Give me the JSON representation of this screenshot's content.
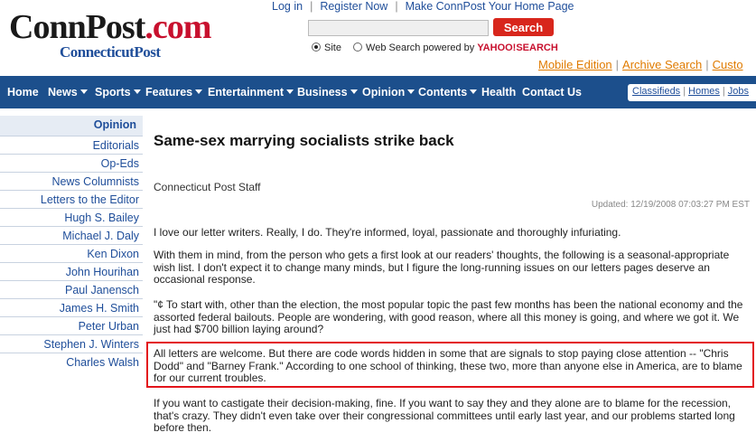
{
  "logo": {
    "main": "ConnPost",
    "dot_com": ".com",
    "sub": "ConnecticutPost"
  },
  "toplinks": [
    "Log in",
    "Register Now",
    "Make ConnPost Your Home Page"
  ],
  "search": {
    "button": "Search",
    "placeholder": ""
  },
  "radios": {
    "site": "Site",
    "web": "Web Search powered by",
    "yahoo": "YAHOO!SEARCH"
  },
  "edition_links": [
    "Mobile Edition",
    "Archive Search",
    "Custo"
  ],
  "nav": {
    "items": [
      {
        "label": "Home",
        "dropdown": false
      },
      {
        "label": "News",
        "dropdown": true
      },
      {
        "label": "Sports",
        "dropdown": true
      },
      {
        "label": "Features",
        "dropdown": true
      },
      {
        "label": "Entertainment",
        "dropdown": true
      },
      {
        "label": "Business",
        "dropdown": true
      },
      {
        "label": "Opinion",
        "dropdown": true
      },
      {
        "label": "Contents",
        "dropdown": true
      },
      {
        "label": "Health",
        "dropdown": false
      },
      {
        "label": "Contact Us",
        "dropdown": false
      }
    ],
    "right_links": [
      "Classifieds",
      "Homes",
      "Jobs"
    ]
  },
  "sidebar": {
    "heading": "Opinion",
    "items": [
      "Editorials",
      "Op-Eds",
      "News Columnists",
      "Letters to the Editor",
      "Hugh S. Bailey",
      "Michael J. Daly",
      "Ken Dixon",
      "John Hourihan",
      "Paul Janensch",
      "James H. Smith",
      "Peter Urban",
      "Stephen J. Winters",
      "Charles Walsh"
    ]
  },
  "article": {
    "title": "Same-sex marrying socialists strike back",
    "byline": "Connecticut Post Staff",
    "updated": "Updated: 12/19/2008 07:03:27 PM EST",
    "paragraphs": [
      "I love our letter writers. Really, I do. They're informed, loyal, passionate and thoroughly infuriating.",
      "With them in mind, from the person who gets a first look at our readers' thoughts, the following is a seasonal-appropriate wish list. I don't expect it to change many minds, but I figure the long-running issues on our letters pages deserve an occasional response.",
      "\"¢ To start with, other than the election, the most popular topic the past few months has been the national economy and the assorted federal bailouts. People are wondering, with good reason, where all this money is going, and where we got it. We just had $700 billion laying around?",
      "All letters are welcome. But there are code words hidden in some that are signals to stop paying close attention -- \"Chris Dodd\" and \"Barney Frank.\" According to one school of thinking, these two, more than anyone else in America, are to blame for our current troubles.",
      "If you want to castigate their decision-making, fine. If you want to say they and they alone are to blame for the recession, that's crazy. They didn't even take over their congressional committees until early last year, and our problems started long before then."
    ]
  },
  "colors": {
    "nav_bg": "#1c4f8c",
    "link": "#1f4e9a",
    "search_btn": "#d8261c",
    "edition_link": "#e07b00",
    "highlight": "#e3141b"
  }
}
